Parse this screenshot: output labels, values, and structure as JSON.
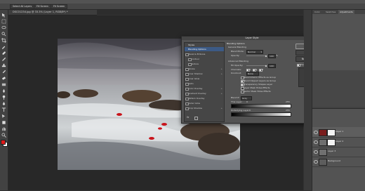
{
  "app": {
    "name": "Photoshop"
  },
  "optionsbar": {
    "buttons": [
      "Select All Layers",
      "Fill Screen",
      "Fit Screen"
    ]
  },
  "document": {
    "tab_title": "DSC01234.jpg @ 33.3% (Layer 1, RGB/8*) *"
  },
  "dialog": {
    "title": "Layer Style",
    "styles_header": "Styles",
    "styles": [
      {
        "label": "Blending Options",
        "selected": true,
        "checkbox": false,
        "plus": false
      },
      {
        "label": "Bevel & Emboss",
        "checkbox": true,
        "plus": false
      },
      {
        "label": "Contour",
        "checkbox": true,
        "plus": false,
        "indent": true
      },
      {
        "label": "Texture",
        "checkbox": true,
        "plus": false,
        "indent": true
      },
      {
        "label": "Stroke",
        "checkbox": true,
        "plus": true
      },
      {
        "label": "Inner Shadow",
        "checkbox": true,
        "plus": true
      },
      {
        "label": "Inner Glow",
        "checkbox": true,
        "plus": false
      },
      {
        "label": "Satin",
        "checkbox": true,
        "plus": false
      },
      {
        "label": "Color Overlay",
        "checkbox": true,
        "plus": true
      },
      {
        "label": "Gradient Overlay",
        "checkbox": true,
        "plus": true
      },
      {
        "label": "Pattern Overlay",
        "checkbox": true,
        "plus": false
      },
      {
        "label": "Outer Glow",
        "checkbox": true,
        "plus": false
      },
      {
        "label": "Drop Shadow",
        "checkbox": true,
        "plus": true
      }
    ],
    "fx_label": "fx",
    "blending": {
      "section_title": "Blending Options",
      "general_title": "General Blending",
      "blend_mode_label": "Blend Mode:",
      "blend_mode_value": "Normal",
      "opacity_label": "Opacity:",
      "opacity_value": "100",
      "opacity_unit": "%",
      "advanced_title": "Advanced Blending",
      "fill_opacity_label": "Fill Opacity:",
      "fill_opacity_value": "100",
      "channels_label": "Channels:",
      "channels": [
        "R",
        "G",
        "B"
      ],
      "knockout_label": "Knockout:",
      "knockout_value": "None",
      "options": [
        {
          "label": "Blend Interior Effects as Group",
          "checked": false
        },
        {
          "label": "Blend Clipped Layers as Group",
          "checked": true
        },
        {
          "label": "Transparency Shapes Layer",
          "checked": true
        },
        {
          "label": "Layer Mask Hides Effects",
          "checked": false
        },
        {
          "label": "Vector Mask Hides Effects",
          "checked": false
        }
      ],
      "blend_if_label": "Blend If:",
      "blend_if_value": "Gray",
      "this_layer_label": "This Layer:",
      "this_layer_range": [
        "0",
        "255"
      ],
      "underlying_label": "Underlying Layer:",
      "underlying_range": [
        "0",
        "255"
      ]
    },
    "buttons": {
      "ok": "OK",
      "cancel": "Cancel",
      "new_style": "New Style...",
      "preview": "Preview"
    }
  },
  "panels": {
    "tabs": [
      "Color",
      "Swatches",
      "Adjustments"
    ],
    "layers": [
      {
        "name": "Layer 1",
        "visible": true,
        "selected": true,
        "mask": true,
        "thumb_color": "#7a1d1d"
      },
      {
        "name": "Layer 2",
        "visible": true,
        "selected": false,
        "mask": true,
        "thumb_color": "#6e6e6e"
      },
      {
        "name": "Layer 3",
        "visible": true,
        "selected": false,
        "mask": false,
        "thumb_color": "#707070"
      },
      {
        "name": "Background",
        "visible": true,
        "selected": false,
        "mask": false,
        "thumb_color": "#5d5d5d"
      }
    ]
  },
  "colors": {
    "foreground": "#e01818",
    "background": "#ffffff",
    "selection": "#3c5a85"
  }
}
